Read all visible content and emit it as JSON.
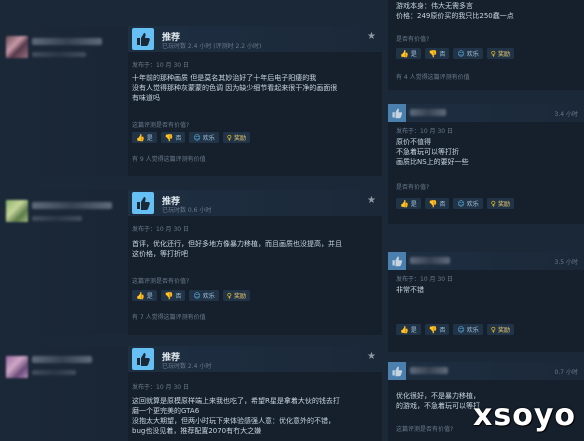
{
  "right_top": {
    "line1": "游戏本身：伟大无需多言",
    "line2": "价格：249原价买的我只比250蠢一点",
    "helpful_q": "是否有价值?",
    "count": "有 4 人觉得这篇评测有价值"
  },
  "buttons": {
    "yes": "是",
    "no": "否",
    "funny": "欢乐",
    "award": "奖励"
  },
  "reviews": [
    {
      "title": "推荐",
      "hours": "已玩时数 2.4 小时 (评测时 2.2 小时)",
      "posted": "发布于：10 月 30 日",
      "lines": [
        "十年前的那种画质 但是莫名其妙治好了十年后电子阳痿的我",
        "没有人觉得那种灰蒙蒙的色调 因为缺少细节看起来很干净的画面很",
        "有味道吗"
      ],
      "helpful_q": "这篇评测是否有价值?",
      "count": "有 9 人觉得这篇评测有价值"
    },
    {
      "title": "推荐",
      "hours": "已玩时数 0.6 小时",
      "posted": "发布于：10 月 30 日",
      "lines": [
        "首评，优化还行，但好多地方像暴力移植，而且画质也没提高，并且",
        "这价格，等打折吧"
      ],
      "helpful_q": "这篇评测是否有价值?",
      "count": "有 7 人觉得这篇评测有价值"
    },
    {
      "title": "推荐",
      "hours": "已玩时数 2.4 小时",
      "posted": "发布于：10 月 30 日",
      "lines": [
        "这回就算是原模原样端上来我也吃了，希望R星是拿着大伙的钱去打",
        "磨一个更完美的GTA6",
        "没抱太大期望，但两小时玩下来体验感强人意：优化意外的不错，",
        "bug也没见着，推荐配置2070有冇大之嫌"
      ]
    }
  ],
  "right_reviews": [
    {
      "hours": "3.4 小时",
      "posted": "发布于：10 月 30 日",
      "lines": [
        "原价不值得",
        "不急着玩可以等打折",
        "画质比NS上的要好一些"
      ],
      "helpful_q": "是否有价值?"
    },
    {
      "hours": "3.5 小时",
      "posted": "发布于：10 月 30 日",
      "lines": [
        "非常不错"
      ]
    },
    {
      "hours": "0.7 小时",
      "posted": "",
      "lines": [
        "优化很好，不是暴力移植，",
        "的游戏，不急着玩可以等打"
      ],
      "helpful_q": "这篇评测是否有价值?"
    }
  ],
  "watermark": "xsoyo"
}
